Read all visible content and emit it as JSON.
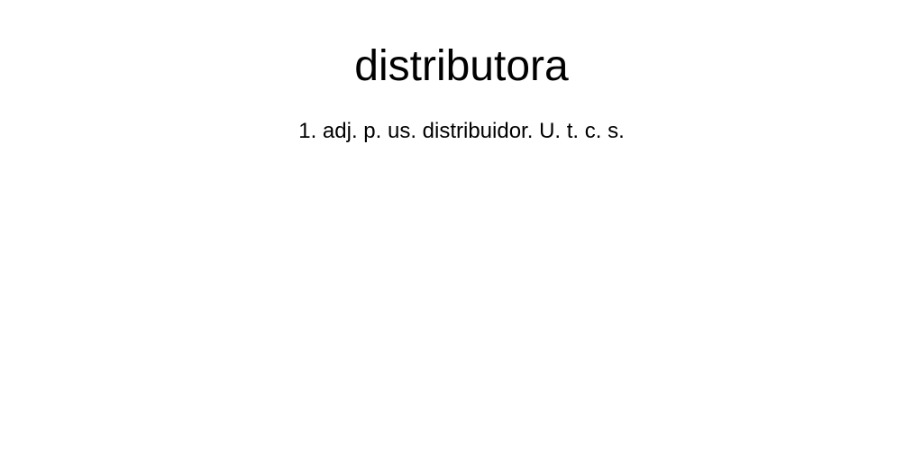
{
  "entry": {
    "headword": "distributora",
    "definition": "1. adj. p. us. distribuidor. U. t. c. s."
  }
}
